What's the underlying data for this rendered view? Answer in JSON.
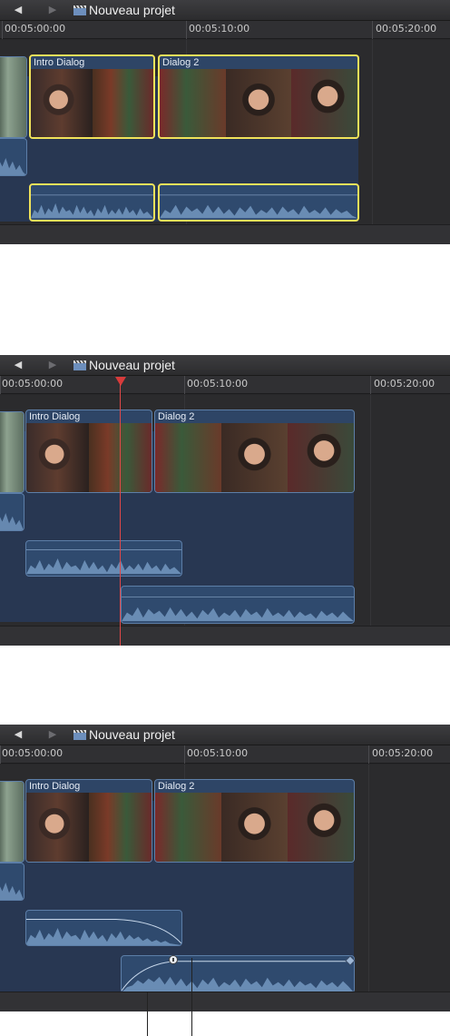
{
  "window": {
    "back_icon": "◀",
    "forward_icon": "▶",
    "project_icon": "clapperboard-icon",
    "project_title": "Nouveau projet"
  },
  "ruler": {
    "ticks": [
      "00:05:00:00",
      "00:05:10:00",
      "00:05:20:00"
    ]
  },
  "clips": {
    "intro": "Intro Dialog",
    "dialog2": "Dialog 2"
  },
  "colors": {
    "selection": "#f0e25a",
    "playhead": "#e04848",
    "clip": "#2e4566",
    "audio": "#2f4a6e",
    "waveform": "#7ea3cc"
  }
}
